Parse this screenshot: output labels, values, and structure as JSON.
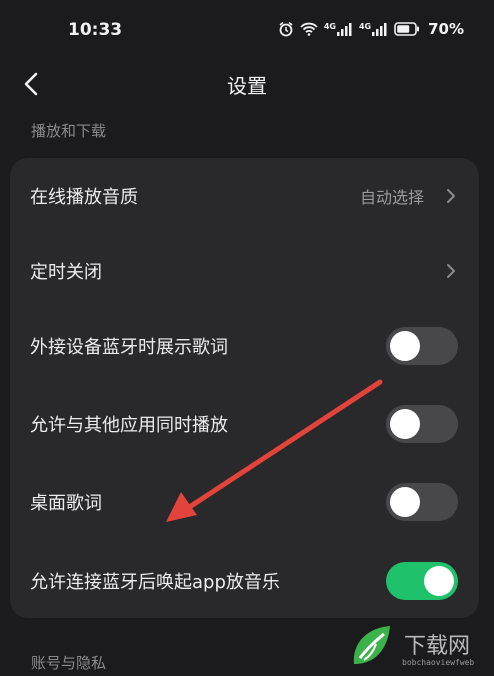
{
  "status_bar": {
    "time": "10:33",
    "network_a": "4G",
    "network_b": "4G",
    "battery": "70%"
  },
  "header": {
    "title": "设置"
  },
  "sections": {
    "playback": "播放和下载",
    "privacy": "账号与隐私"
  },
  "rows": [
    {
      "label": "在线播放音质",
      "value": "自动选择"
    },
    {
      "label": "定时关闭"
    },
    {
      "label": "外接设备蓝牙时展示歌词",
      "toggle_on": false
    },
    {
      "label": "允许与其他应用同时播放",
      "toggle_on": false
    },
    {
      "label": "桌面歌词",
      "toggle_on": false
    },
    {
      "label": "允许连接蓝牙后唤起app放音乐",
      "toggle_on": true
    }
  ],
  "colors": {
    "background": "#1b1b1d",
    "card": "#29292b",
    "toggle_on": "#1fc26a",
    "annotation_arrow": "#e2433a"
  },
  "watermark": {
    "text": "下载网",
    "sub": "bobchaoviewfweb"
  }
}
